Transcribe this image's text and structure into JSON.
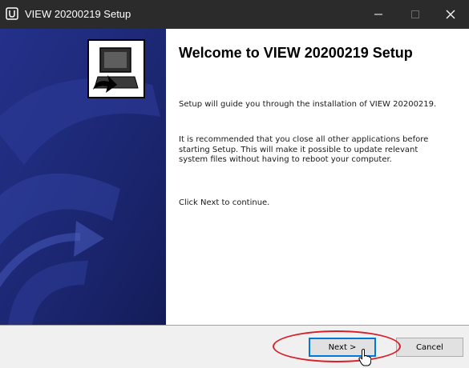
{
  "window": {
    "title": "VIEW 20200219 Setup"
  },
  "titlebar": {
    "icons": [
      "installer-app-icon",
      "minimize-icon",
      "maximize-icon",
      "close-icon"
    ]
  },
  "content": {
    "heading": "Welcome to VIEW 20200219 Setup",
    "paragraphs": [
      "Setup will guide you through the installation of VIEW 20200219.",
      "It is recommended that you close all other applications before starting Setup. This will make it possible to update relevant system files without having to reboot your computer.",
      "Click Next to continue."
    ]
  },
  "footer": {
    "next_label": "Next >",
    "cancel_label": "Cancel"
  },
  "colors": {
    "titlebar": "#2b2b2b",
    "sidebar": "#1a2570",
    "highlight_ellipse": "#d81e28",
    "focus_border": "#0078d7"
  },
  "sidebar": {
    "icon": "computer-install-icon"
  },
  "annotation": {
    "shape": "red-ellipse-around-next-button"
  }
}
